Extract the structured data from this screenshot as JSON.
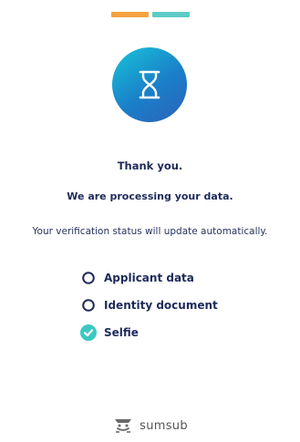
{
  "progress": {
    "segments": [
      {
        "color": "#F4A340"
      },
      {
        "color": "#5ECBC6"
      }
    ]
  },
  "hero": {
    "icon": "hourglass-icon",
    "gradient_colors": [
      "#18C4D8",
      "#1A7FC9",
      "#2B63B8"
    ]
  },
  "heading": {
    "title": "Thank you.",
    "subtitle": "We are processing your data.",
    "info": "Your verification status will update automatically."
  },
  "steps": [
    {
      "label": "Applicant data",
      "status": "pending",
      "icon": "empty-circle-icon"
    },
    {
      "label": "Identity document",
      "status": "pending",
      "icon": "empty-circle-icon"
    },
    {
      "label": "Selfie",
      "status": "done",
      "icon": "check-circle-icon"
    }
  ],
  "brand": {
    "name": "sumsub",
    "icon": "sumsub-logo-icon"
  },
  "colors": {
    "text_primary": "#1E2A5A",
    "accent_teal": "#3CC8C0"
  }
}
